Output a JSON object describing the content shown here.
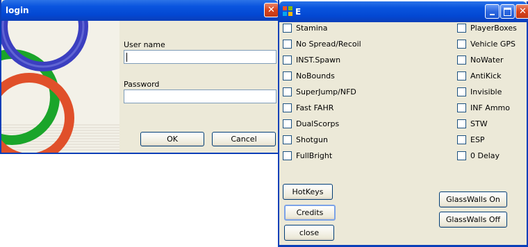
{
  "login": {
    "title": "login",
    "username_label": "User name",
    "username_value": "",
    "password_label": "Password",
    "password_value": "",
    "ok_label": "OK",
    "cancel_label": "Cancel"
  },
  "ewin": {
    "title": "E",
    "left_options": [
      "Stamina",
      "No Spread/Recoil",
      "INST.Spawn",
      "NoBounds",
      "SuperJump/NFD",
      "Fast FAHR",
      "DualScorps",
      "Shotgun",
      "FullBright"
    ],
    "right_options": [
      "PlayerBoxes",
      "Vehicle GPS",
      "NoWater",
      "AntiKick",
      "Invisible",
      "INF Ammo",
      "STW",
      "ESP",
      "0 Delay"
    ],
    "hotkeys_label": "HotKeys",
    "credits_label": "Credits",
    "close_label": "close",
    "glasswalls_on_label": "GlassWalls On",
    "glasswalls_off_label": "GlassWalls Off"
  },
  "colors": {
    "titlebar_blue": "#0a55df",
    "close_red": "#d7421b",
    "window_face": "#ece9d8",
    "ring_blue": "#3b3fc0",
    "ring_green": "#1aa52a",
    "ring_orange": "#e0502a"
  },
  "icons": {
    "login_close": "close-icon",
    "e_app": "windows-flag-icon",
    "e_minimize": "minimize-icon",
    "e_maximize": "maximize-icon",
    "e_close": "close-icon"
  }
}
